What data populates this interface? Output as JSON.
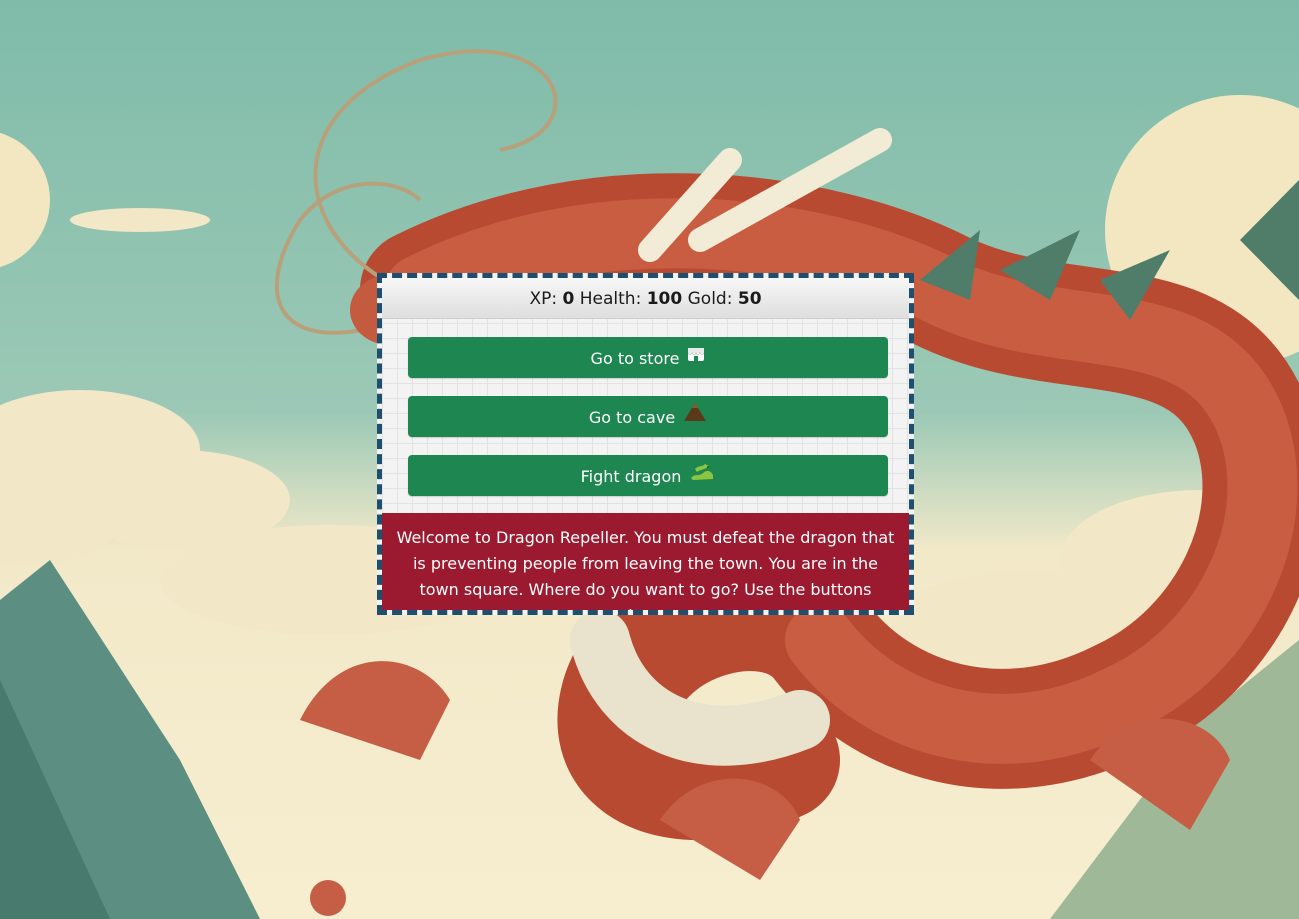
{
  "stats": {
    "xp_label": "XP:",
    "xp_value": "0",
    "health_label": "Health:",
    "health_value": "100",
    "gold_label": "Gold:",
    "gold_value": "50"
  },
  "buttons": [
    {
      "label": "Go to store",
      "icon": "store-icon"
    },
    {
      "label": "Go to cave",
      "icon": "mountain-icon"
    },
    {
      "label": "Fight dragon",
      "icon": "dragon-icon"
    }
  ],
  "message": "Welcome to Dragon Repeller. You must defeat the dragon that is preventing people from leaving the town. You are in the town square. Where do you want to go? Use the buttons above.",
  "colors": {
    "button_green": "#1d8651",
    "message_red": "#9b1a30",
    "border_blue": "#1e4f6e",
    "sky_teal": "#86bfae"
  }
}
